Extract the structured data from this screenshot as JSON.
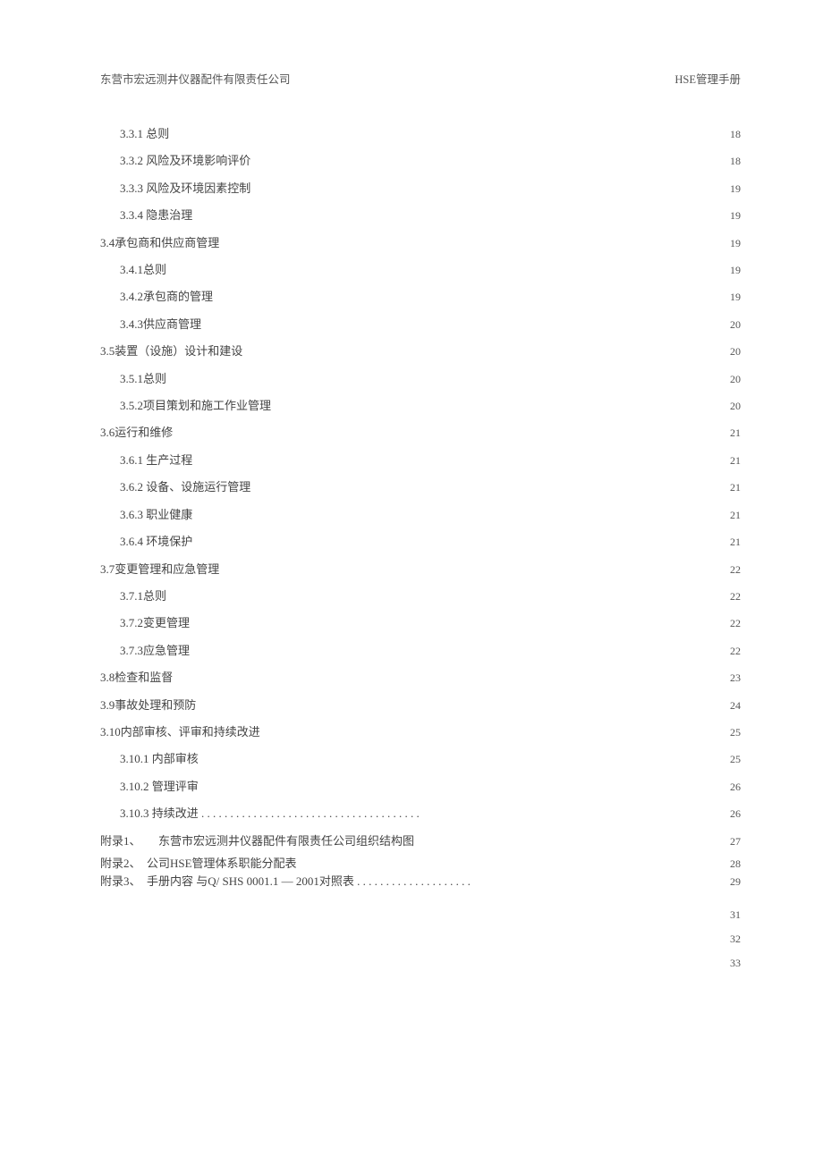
{
  "header": {
    "left": "东营市宏远测井仪器配件有限责任公司",
    "right": "HSE管理手册"
  },
  "toc": [
    {
      "level": 2,
      "label": "3.3.1 总则",
      "page": "18"
    },
    {
      "level": 2,
      "label": "3.3.2 风险及环境影响评价",
      "page": "18"
    },
    {
      "level": 2,
      "label": "3.3.3 风险及环境因素控制",
      "page": "19"
    },
    {
      "level": 2,
      "label": "3.3.4 隐患治理",
      "page": "19"
    },
    {
      "level": 1,
      "label": "3.4承包商和供应商管理",
      "page": "19"
    },
    {
      "level": 2,
      "label": "3.4.1总则",
      "page": "19"
    },
    {
      "level": 2,
      "label": "3.4.2承包商的管理",
      "page": "19"
    },
    {
      "level": 2,
      "label": "3.4.3供应商管理",
      "page": "20"
    },
    {
      "level": 1,
      "label": "3.5装置（设施）设计和建设",
      "page": "20"
    },
    {
      "level": 2,
      "label": "3.5.1总则",
      "page": "20"
    },
    {
      "level": 2,
      "label": "3.5.2项目策划和施工作业管理",
      "page": "20"
    },
    {
      "level": 1,
      "label": "3.6运行和维修",
      "page": "21"
    },
    {
      "level": 2,
      "label": "3.6.1 生产过程",
      "page": "21"
    },
    {
      "level": 2,
      "label": "3.6.2 设备、设施运行管理",
      "page": "21"
    },
    {
      "level": 2,
      "label": "3.6.3 职业健康",
      "page": "21"
    },
    {
      "level": 2,
      "label": "3.6.4 环境保护",
      "page": "21"
    },
    {
      "level": 1,
      "label": "3.7变更管理和应急管理",
      "page": "22"
    },
    {
      "level": 2,
      "label": "3.7.1总则",
      "page": "22"
    },
    {
      "level": 2,
      "label": "3.7.2变更管理",
      "page": "22"
    },
    {
      "level": 2,
      "label": "3.7.3应急管理",
      "page": "22"
    },
    {
      "level": 1,
      "label": "3.8检查和监督",
      "page": "23"
    },
    {
      "level": 1,
      "label": "3.9事故处理和预防",
      "page": "24"
    },
    {
      "level": 1,
      "label": "3.10内部审核、评审和持续改进",
      "page": "25"
    },
    {
      "level": 2,
      "label": "3.10.1  内部审核",
      "page": "25"
    },
    {
      "level": 2,
      "label": "3.10.2 管理评审",
      "page": "26"
    },
    {
      "level": 2,
      "label": "3.10.3 持续改进 . . . . . . . . . . . . . . . . . . . . . . . . . . . . . . . . . . . . . .",
      "page": "26"
    },
    {
      "level": 1,
      "label": "附录1、　　东营市宏远测井仪器配件有限责任公司组织结构图",
      "page": "27"
    },
    {
      "level": 1,
      "label": "附录2、　公司HSE管理体系职能分配表",
      "page": "28",
      "tight": true
    },
    {
      "level": 1,
      "label": "附录3、　手册内容 与Q/ SHS 0001.1 — 2001对照表 . . . . . . . . . . . . . . . . . . . .",
      "page": "29",
      "tight": true
    }
  ],
  "trailing_pages": [
    "31",
    "32",
    "33"
  ]
}
